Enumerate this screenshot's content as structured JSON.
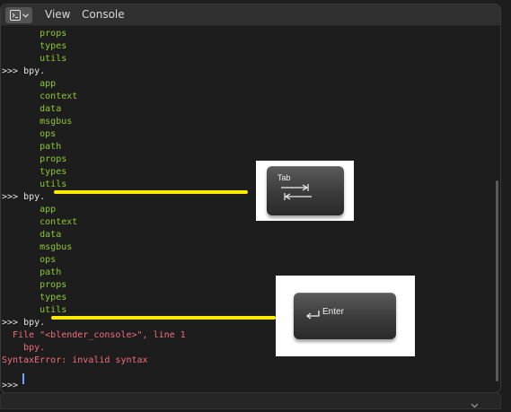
{
  "header": {
    "editor_type_icon": "console-icon",
    "menu": [
      "View",
      "Console"
    ]
  },
  "console": {
    "lines": [
      {
        "text": "       props",
        "color": "green"
      },
      {
        "text": "       types",
        "color": "green"
      },
      {
        "text": "       utils",
        "color": "green"
      },
      {
        "text": ">>> bpy.",
        "color": "white"
      },
      {
        "text": "       app",
        "color": "green"
      },
      {
        "text": "       context",
        "color": "green"
      },
      {
        "text": "       data",
        "color": "green"
      },
      {
        "text": "       msgbus",
        "color": "green"
      },
      {
        "text": "       ops",
        "color": "green"
      },
      {
        "text": "       path",
        "color": "green"
      },
      {
        "text": "       props",
        "color": "green"
      },
      {
        "text": "       types",
        "color": "green"
      },
      {
        "text": "       utils",
        "color": "green"
      },
      {
        "text": ">>> bpy.",
        "color": "white"
      },
      {
        "text": "       app",
        "color": "green"
      },
      {
        "text": "       context",
        "color": "green"
      },
      {
        "text": "       data",
        "color": "green"
      },
      {
        "text": "       msgbus",
        "color": "green"
      },
      {
        "text": "       ops",
        "color": "green"
      },
      {
        "text": "       path",
        "color": "green"
      },
      {
        "text": "       props",
        "color": "green"
      },
      {
        "text": "       types",
        "color": "green"
      },
      {
        "text": "       utils",
        "color": "green"
      },
      {
        "text": ">>> bpy.",
        "color": "white"
      },
      {
        "text": "  File \"<blender_console>\", line 1",
        "color": "red"
      },
      {
        "text": "    bpy.",
        "color": "red"
      },
      {
        "text": "SyntaxError: invalid syntax",
        "color": "red"
      },
      {
        "text": "",
        "color": "white"
      },
      {
        "text": ">>> ",
        "color": "white"
      }
    ]
  },
  "overlays": {
    "tab_key_label": "Tab",
    "enter_key_label": "Enter"
  },
  "colors": {
    "output_green": "#8fc633",
    "error_red": "#f06d7f",
    "highlight_yellow": "#ffeb00",
    "cursor_blue": "#6fa3ff"
  }
}
